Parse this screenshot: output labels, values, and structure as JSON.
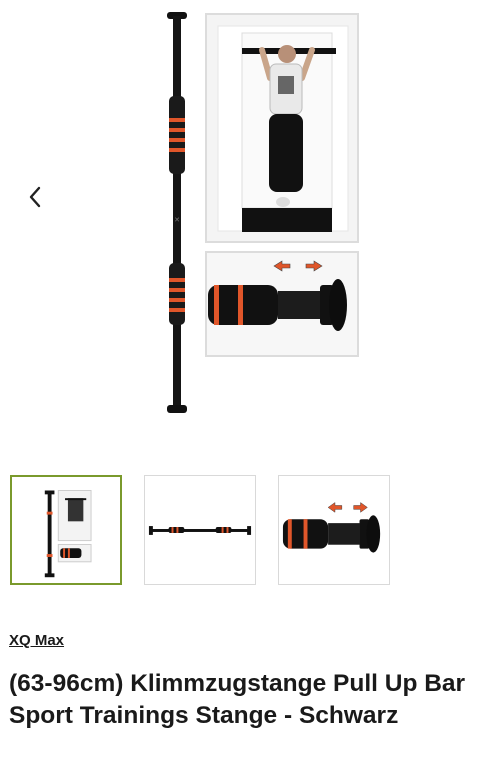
{
  "gallery": {
    "prev_icon": "chevron-left-icon",
    "main_image_alt": "",
    "thumbnails": [
      {
        "name": "thumb-full-product",
        "selected": true
      },
      {
        "name": "thumb-bar-horizontal",
        "selected": false
      },
      {
        "name": "thumb-end-cap-detail",
        "selected": false
      }
    ]
  },
  "product": {
    "brand": "XQ Max",
    "title": "(63-96cm) Klimmzugstange Pull Up Bar Sport Trainings Stange - Schwarz"
  },
  "colors": {
    "selected_border": "#7a9a2c",
    "accent_orange": "#e0562a",
    "bar_black": "#111111"
  }
}
